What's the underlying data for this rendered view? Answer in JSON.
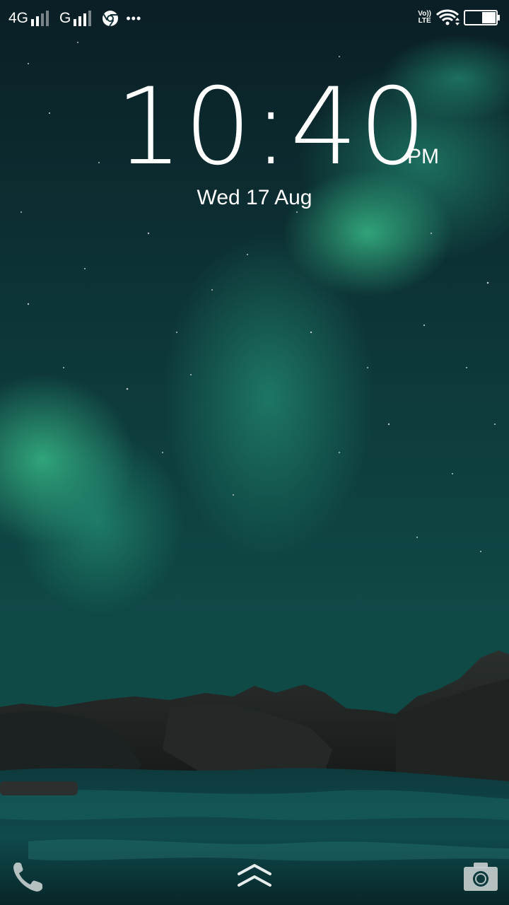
{
  "status_bar": {
    "network_1_label": "4G",
    "network_2_label": "G",
    "more_indicator": "•••",
    "volte_line1": "Vo))",
    "volte_line2": "LTE",
    "icons": [
      "signal-icon",
      "chrome-icon",
      "more-dots-icon",
      "volte-icon",
      "wifi-icon",
      "battery-icon"
    ]
  },
  "lock_screen": {
    "time": "10:40",
    "ampm": "PM",
    "date": "Wed 17 Aug"
  },
  "bottom_bar": {
    "icons": [
      "phone-icon",
      "swipe-up-icon",
      "camera-icon"
    ]
  },
  "colors": {
    "text": "#ffffff",
    "sky_dark": "#0d2f33",
    "aurora": "#2fa07a"
  }
}
